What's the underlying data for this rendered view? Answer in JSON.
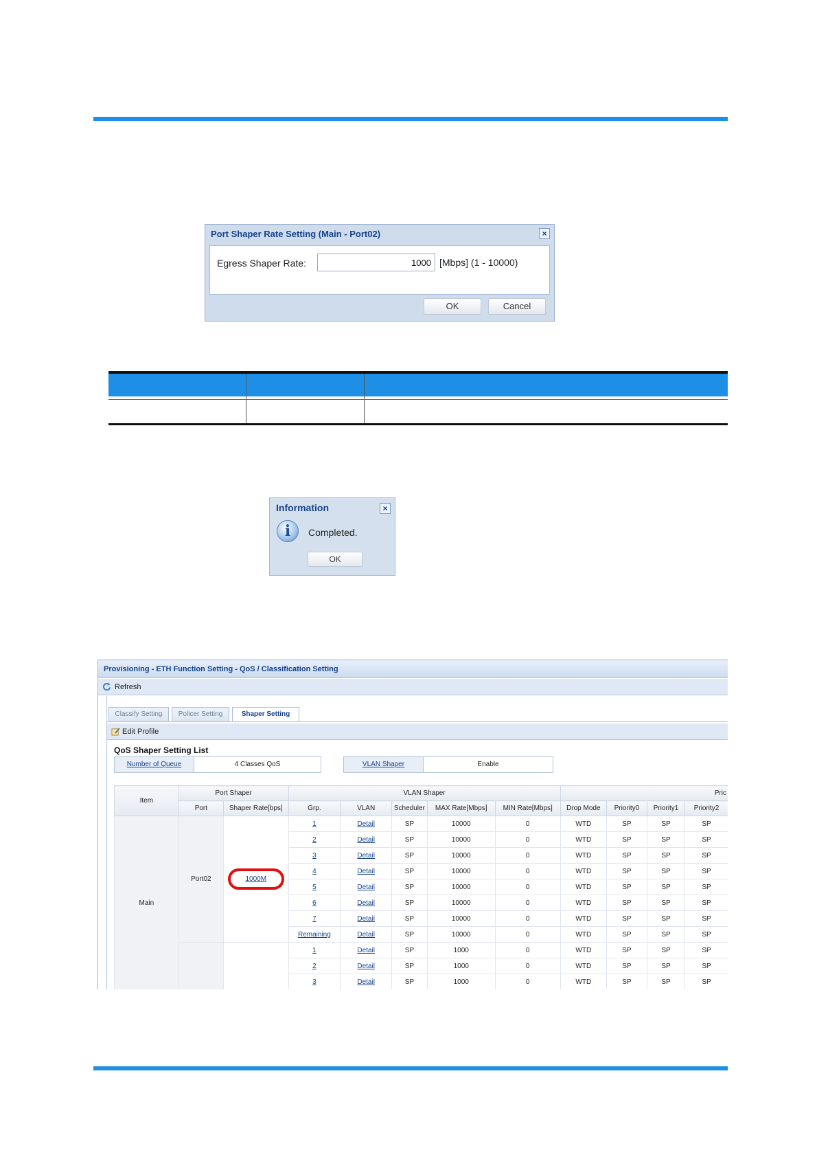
{
  "dialog_shaper": {
    "title": "Port Shaper Rate Setting (Main - Port02)",
    "close": "×",
    "label": "Egress Shaper Rate:",
    "value": "1000",
    "unit": "[Mbps] (1 - 10000)",
    "ok": "OK",
    "cancel": "Cancel"
  },
  "dialog_info": {
    "title": "Information",
    "close": "×",
    "icon": "i",
    "message": "Completed.",
    "ok": "OK"
  },
  "panel": {
    "breadcrumb": "Provisioning - ETH Function Setting - QoS / Classification Setting",
    "refresh": "Refresh",
    "tabs": [
      "Classify Setting",
      "Policer Setting",
      "Shaper Setting"
    ],
    "edit_profile": "Edit Profile",
    "list_title": "QoS Shaper Setting List",
    "queue_key": "Number of Queue",
    "queue_value": "4 Classes QoS",
    "vlan_key": "VLAN Shaper",
    "vlan_value": "Enable",
    "headers_top": {
      "item": "Item",
      "port_shaper": "Port Shaper",
      "vlan_shaper": "VLAN Shaper",
      "pri": "Pric"
    },
    "headers_sub": {
      "port": "Port",
      "shaper_rate": "Shaper Rate[bps]",
      "grp": "Grp.",
      "vlan": "VLAN",
      "scheduler": "Scheduler",
      "max_rate": "MAX Rate[Mbps]",
      "min_rate": "MIN Rate[Mbps]",
      "drop_mode": "Drop Mode",
      "p0": "Priority0",
      "p1": "Priority1",
      "p2": "Priority2"
    },
    "item_value": "Main",
    "port_value": "Port02",
    "shaper_rate_value": "1000M",
    "rows": [
      {
        "grp": "1",
        "vlan": "Detail",
        "scheduler": "SP",
        "max": "10000",
        "min": "0",
        "drop": "WTD",
        "p0": "SP",
        "p1": "SP",
        "p2": "SP"
      },
      {
        "grp": "2",
        "vlan": "Detail",
        "scheduler": "SP",
        "max": "10000",
        "min": "0",
        "drop": "WTD",
        "p0": "SP",
        "p1": "SP",
        "p2": "SP"
      },
      {
        "grp": "3",
        "vlan": "Detail",
        "scheduler": "SP",
        "max": "10000",
        "min": "0",
        "drop": "WTD",
        "p0": "SP",
        "p1": "SP",
        "p2": "SP"
      },
      {
        "grp": "4",
        "vlan": "Detail",
        "scheduler": "SP",
        "max": "10000",
        "min": "0",
        "drop": "WTD",
        "p0": "SP",
        "p1": "SP",
        "p2": "SP"
      },
      {
        "grp": "5",
        "vlan": "Detail",
        "scheduler": "SP",
        "max": "10000",
        "min": "0",
        "drop": "WTD",
        "p0": "SP",
        "p1": "SP",
        "p2": "SP"
      },
      {
        "grp": "6",
        "vlan": "Detail",
        "scheduler": "SP",
        "max": "10000",
        "min": "0",
        "drop": "WTD",
        "p0": "SP",
        "p1": "SP",
        "p2": "SP"
      },
      {
        "grp": "7",
        "vlan": "Detail",
        "scheduler": "SP",
        "max": "10000",
        "min": "0",
        "drop": "WTD",
        "p0": "SP",
        "p1": "SP",
        "p2": "SP"
      },
      {
        "grp": "Remaining",
        "vlan": "Detail",
        "scheduler": "SP",
        "max": "10000",
        "min": "0",
        "drop": "WTD",
        "p0": "SP",
        "p1": "SP",
        "p2": "SP"
      },
      {
        "grp": "1",
        "vlan": "Detail",
        "scheduler": "SP",
        "max": "1000",
        "min": "0",
        "drop": "WTD",
        "p0": "SP",
        "p1": "SP",
        "p2": "SP"
      },
      {
        "grp": "2",
        "vlan": "Detail",
        "scheduler": "SP",
        "max": "1000",
        "min": "0",
        "drop": "WTD",
        "p0": "SP",
        "p1": "SP",
        "p2": "SP"
      },
      {
        "grp": "3",
        "vlan": "Detail",
        "scheduler": "SP",
        "max": "1000",
        "min": "0",
        "drop": "WTD",
        "p0": "SP",
        "p1": "SP",
        "p2": "SP"
      }
    ]
  },
  "colors": {
    "accent_blue": "#1e8fe6",
    "highlight_red": "#e01010",
    "title_blue": "#15428b"
  }
}
